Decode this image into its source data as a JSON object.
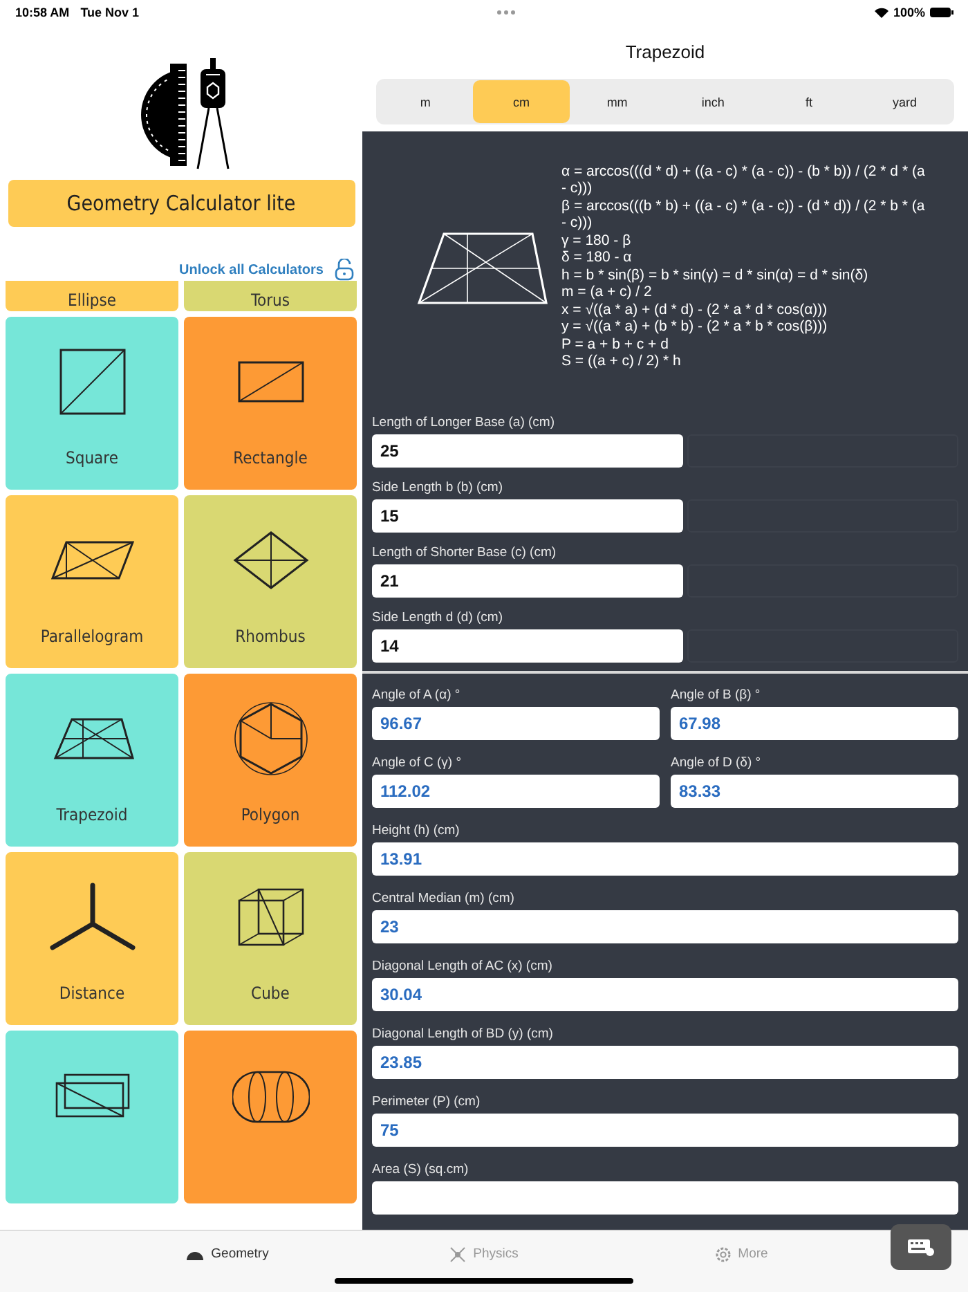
{
  "status_bar": {
    "time": "10:58 AM",
    "date": "Tue Nov 1",
    "battery": "100%"
  },
  "app": {
    "title": "Geometry Calculator lite",
    "unlock_link": "Unlock all Calculators"
  },
  "calculators": [
    {
      "label": "Ellipse",
      "color": "#fecb55",
      "partial": true
    },
    {
      "label": "Torus",
      "color": "#d9d872",
      "partial": true
    },
    {
      "label": "Square",
      "color": "#76e6d8"
    },
    {
      "label": "Rectangle",
      "color": "#fd9a35"
    },
    {
      "label": "Parallelogram",
      "color": "#fecb55"
    },
    {
      "label": "Rhombus",
      "color": "#d9d872"
    },
    {
      "label": "Trapezoid",
      "color": "#76e6d8"
    },
    {
      "label": "Polygon",
      "color": "#fd9a35"
    },
    {
      "label": "Distance",
      "color": "#fecb55"
    },
    {
      "label": "Cube",
      "color": "#d9d872"
    },
    {
      "color": "#76e6d8"
    },
    {
      "color": "#fd9a35"
    }
  ],
  "page_title": "Trapezoid",
  "units": [
    {
      "label": "m",
      "selected": false
    },
    {
      "label": "cm",
      "selected": true
    },
    {
      "label": "mm",
      "selected": false
    },
    {
      "label": "inch",
      "selected": false
    },
    {
      "label": "ft",
      "selected": false
    },
    {
      "label": "yard",
      "selected": false
    }
  ],
  "formulas": [
    "α = arccos(((d * d) + ((a - c) * (a - c)) - (b * b)) / (2 * d * (a - c)))",
    "β = arccos(((b * b) + ((a - c) * (a - c)) - (d * d)) / (2 * b * (a - c)))",
    "γ = 180 - β",
    "δ = 180 - α",
    "h = b * sin(β) = b * sin(γ) = d * sin(α) = d * sin(δ)",
    "m = (a + c) / 2",
    "x = √((a * a) + (d * d) - (2 * a * d * cos(α)))",
    "y = √((a * a) + (b * b) - (2 * a * b * cos(β)))",
    "P = a + b + c + d",
    "S = ((a + c) / 2) * h"
  ],
  "inputs": [
    {
      "label": "Length of Longer Base (a) (cm)",
      "value": "25"
    },
    {
      "label": "Side Length b (b) (cm)",
      "value": "15"
    },
    {
      "label": "Length of Shorter Base (c) (cm)",
      "value": "21"
    },
    {
      "label": "Side Length d (d) (cm)",
      "value": "14"
    }
  ],
  "results": [
    {
      "label": "Angle of A (α) °",
      "value": "96.67",
      "kind": "half"
    },
    {
      "label": "Angle of B (β) °",
      "value": "67.98",
      "kind": "half"
    },
    {
      "label": "Angle of C (γ) °",
      "value": "112.02",
      "kind": "half"
    },
    {
      "label": "Angle of D (δ) °",
      "value": "83.33",
      "kind": "half"
    },
    {
      "label": "Height (h) (cm)",
      "value": "13.91",
      "kind": "full"
    },
    {
      "label": "Central Median (m) (cm)",
      "value": "23",
      "kind": "full"
    },
    {
      "label": "Diagonal Length of AC (x) (cm)",
      "value": "30.04",
      "kind": "full"
    },
    {
      "label": "Diagonal Length of BD (y) (cm)",
      "value": "23.85",
      "kind": "full"
    },
    {
      "label": "Perimeter (P) (cm)",
      "value": "75",
      "kind": "full"
    },
    {
      "label": "Area (S) (sq.cm)",
      "kind": "full"
    }
  ],
  "tabs": [
    {
      "label": "Geometry",
      "selected": true
    },
    {
      "label": "Physics",
      "selected": false
    },
    {
      "label": "More",
      "selected": false
    }
  ]
}
